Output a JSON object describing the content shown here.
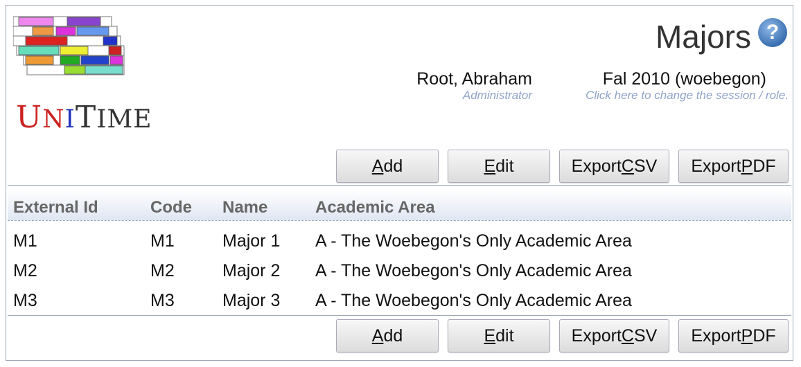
{
  "app": {
    "logo_text": "UniTime"
  },
  "page": {
    "title": "Majors"
  },
  "user": {
    "name": "Root, Abraham",
    "role": "Administrator"
  },
  "session": {
    "name": "Fal 2010 (woebegon)",
    "hint": "Click here to change the session / role."
  },
  "buttons": {
    "add": {
      "pre": "",
      "key": "A",
      "post": "dd"
    },
    "edit": {
      "pre": "",
      "key": "E",
      "post": "dit"
    },
    "export_csv": {
      "pre": "Export ",
      "key": "C",
      "post": "SV"
    },
    "export_pdf": {
      "pre": "Export ",
      "key": "P",
      "post": "DF"
    }
  },
  "table": {
    "columns": [
      "External Id",
      "Code",
      "Name",
      "Academic Area"
    ],
    "rows": [
      [
        "M1",
        "M1",
        "Major 1",
        "A - The Woebegon's Only Academic Area"
      ],
      [
        "M2",
        "M2",
        "Major 2",
        "A - The Woebegon's Only Academic Area"
      ],
      [
        "M3",
        "M3",
        "Major 3",
        "A - The Woebegon's Only Academic Area"
      ]
    ]
  },
  "colors": {
    "border": "#9aa6b7",
    "hint": "#8fa3c8",
    "help_icon": "#3a6fb0"
  }
}
